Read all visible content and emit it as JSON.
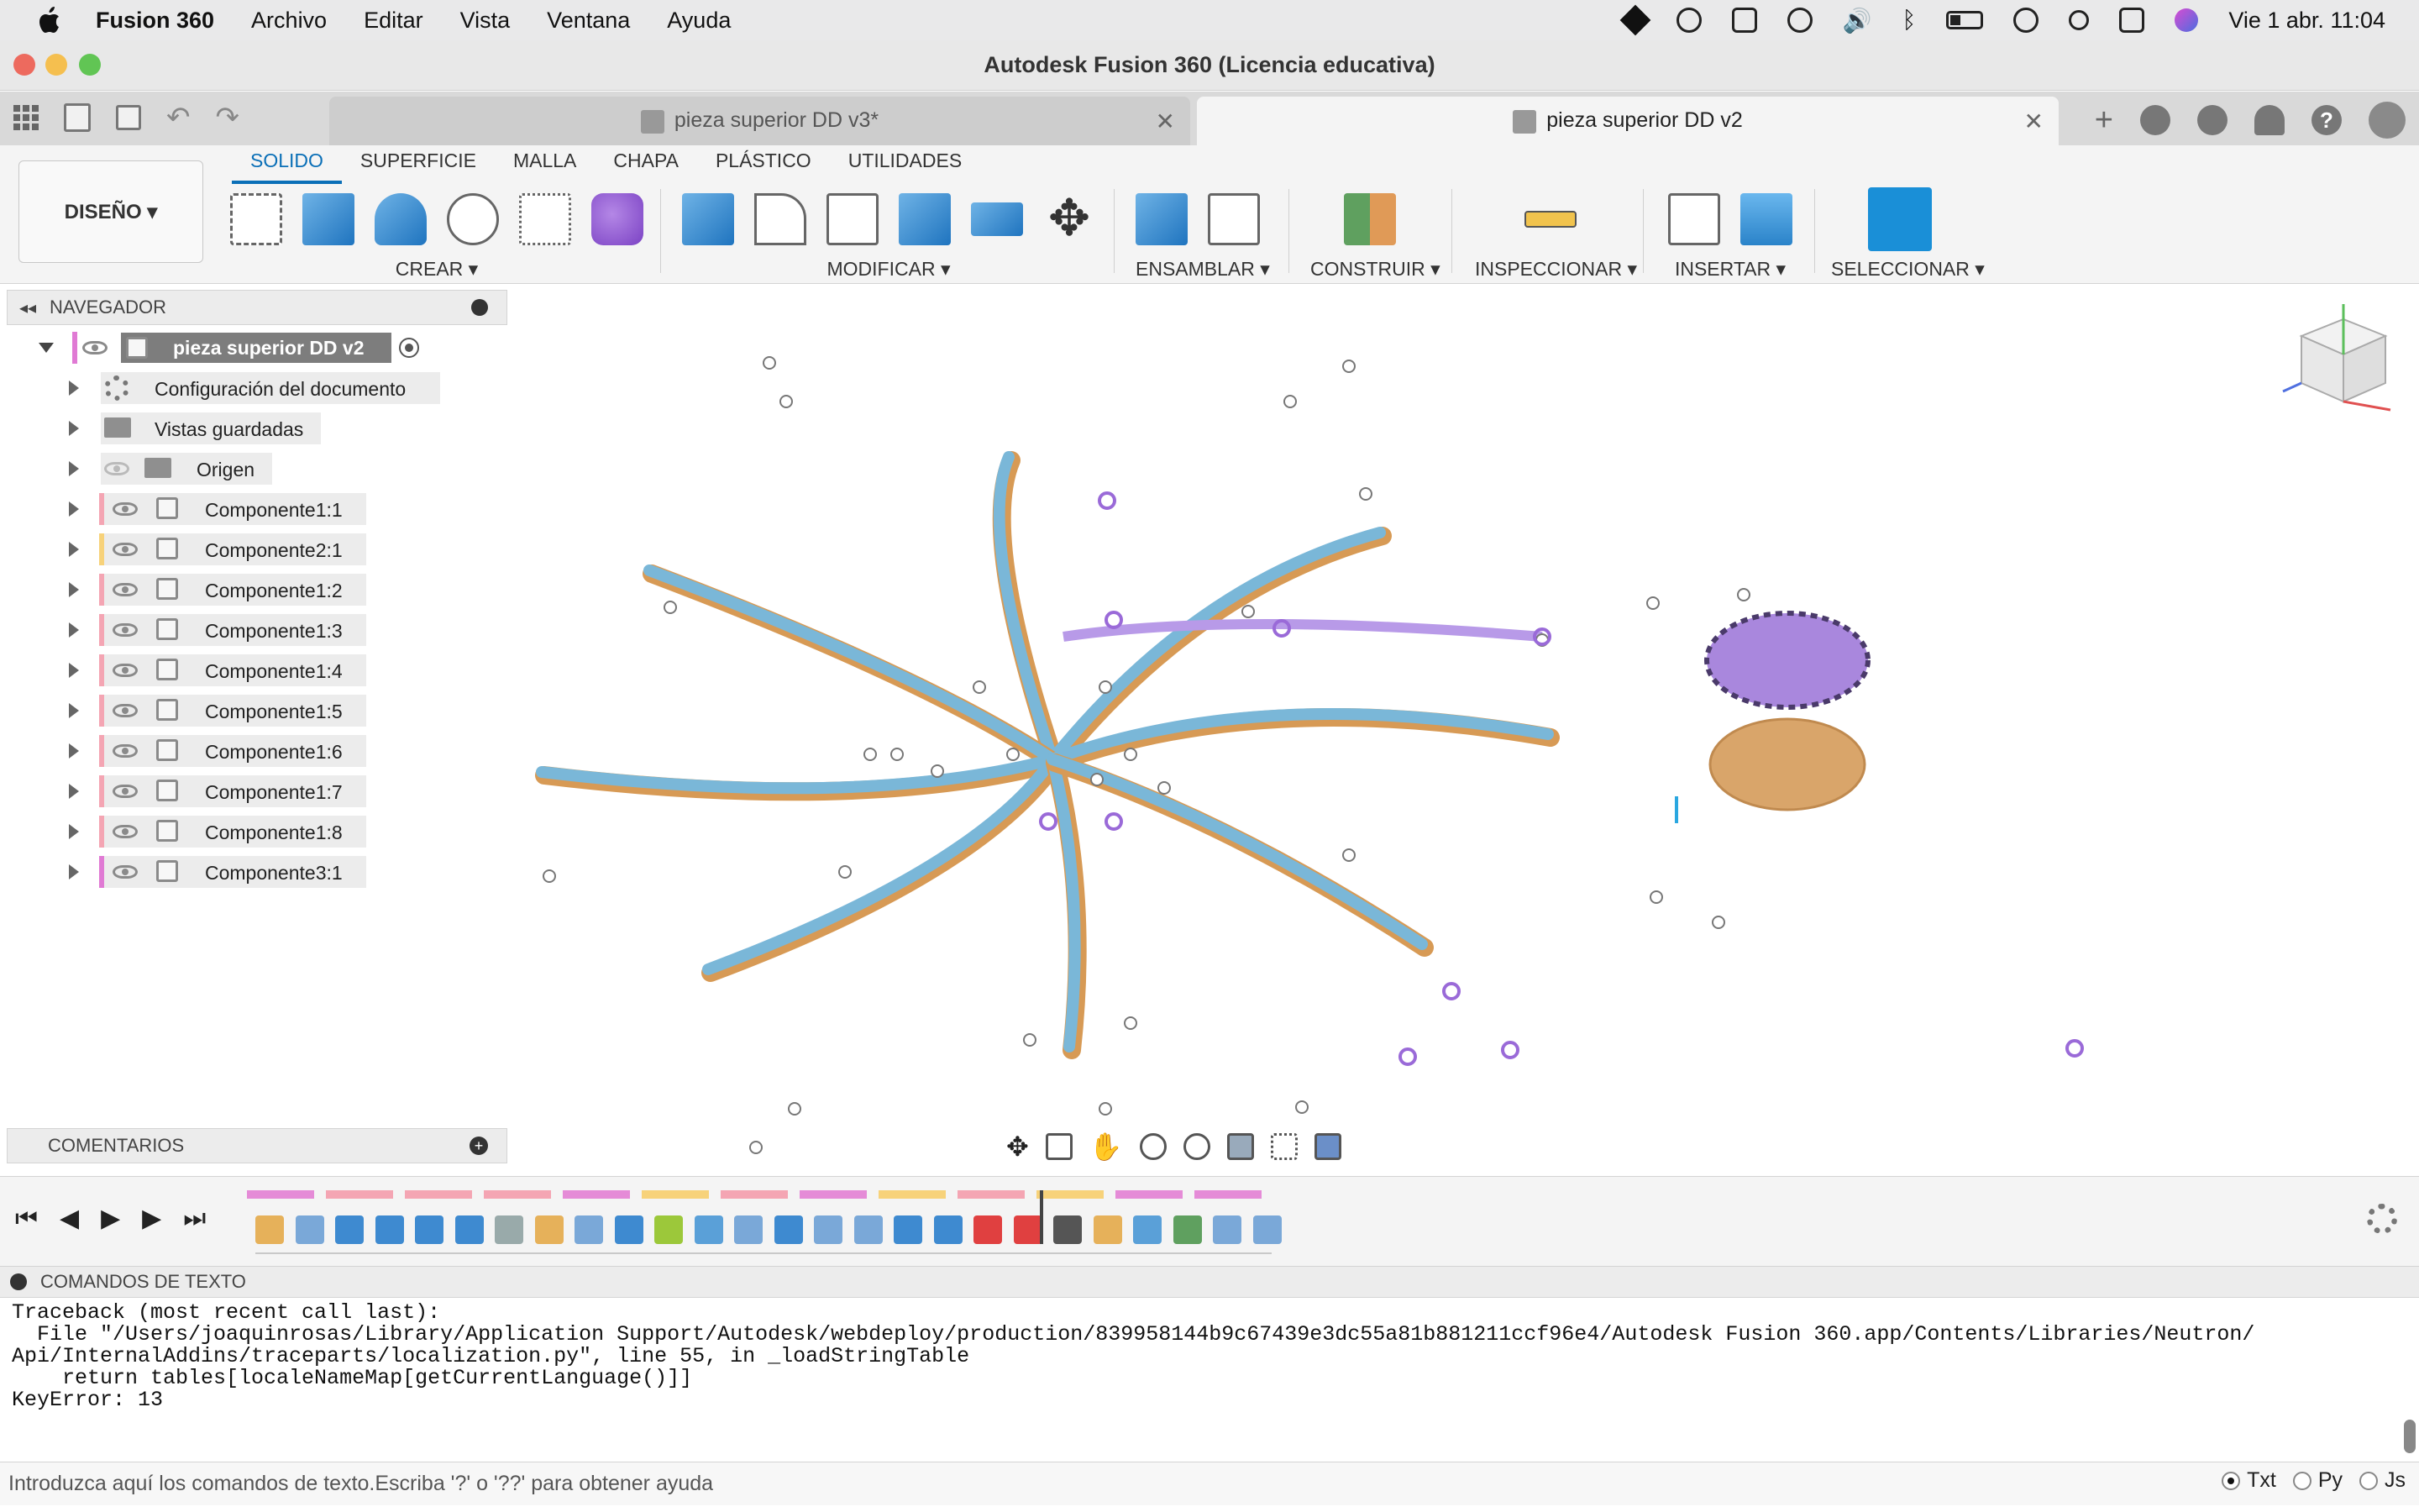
{
  "menubar": {
    "app_name": "Fusion 360",
    "items": [
      "Archivo",
      "Editar",
      "Vista",
      "Ventana",
      "Ayuda"
    ],
    "clock": "Vie 1 abr.  11:04"
  },
  "window": {
    "title": "Autodesk Fusion 360 (Licencia educativa)"
  },
  "tabs": [
    {
      "label": "pieza superior DD v3*",
      "active": false
    },
    {
      "label": "pieza superior DD v2",
      "active": true
    }
  ],
  "ribbon": {
    "workspace": "DISEÑO ▾",
    "tabs": [
      "SOLIDO",
      "SUPERFICIE",
      "MALLA",
      "CHAPA",
      "PLÁSTICO",
      "UTILIDADES"
    ],
    "groups": {
      "create": "CREAR ▾",
      "modify": "MODIFICAR ▾",
      "assemble": "ENSAMBLAR ▾",
      "construct": "CONSTRUIR ▾",
      "inspect": "INSPECCIONAR ▾",
      "insert": "INSERTAR ▾",
      "select": "SELECCIONAR ▾"
    }
  },
  "navigator": {
    "title": "NAVEGADOR",
    "root": "pieza superior DD v2",
    "items": [
      {
        "label": "Configuración del documento",
        "kind": "settings"
      },
      {
        "label": "Vistas guardadas",
        "kind": "folder"
      },
      {
        "label": "Origen",
        "kind": "origin"
      },
      {
        "label": "Componente1:1",
        "color": "#f4a5b3"
      },
      {
        "label": "Componente2:1",
        "color": "#f7d27a"
      },
      {
        "label": "Componente1:2",
        "color": "#f4a5b3"
      },
      {
        "label": "Componente1:3",
        "color": "#f4a5b3"
      },
      {
        "label": "Componente1:4",
        "color": "#f4a5b3"
      },
      {
        "label": "Componente1:5",
        "color": "#f4a5b3"
      },
      {
        "label": "Componente1:6",
        "color": "#f4a5b3"
      },
      {
        "label": "Componente1:7",
        "color": "#f4a5b3"
      },
      {
        "label": "Componente1:8",
        "color": "#f4a5b3"
      },
      {
        "label": "Componente3:1",
        "color": "#e07ad4"
      }
    ]
  },
  "comments": {
    "title": "COMENTARIOS"
  },
  "text_commands": {
    "title": "COMANDOS DE TEXTO",
    "output": "Traceback (most recent call last):\n  File \"/Users/joaquinrosas/Library/Application Support/Autodesk/webdeploy/production/839958144b9c67439e3dc55a81b881211ccf96e4/Autodesk Fusion 360.app/Contents/Libraries/Neutron/\nApi/InternalAddins/traceparts/localization.py\", line 55, in _loadStringTable\n    return tables[localeNameMap[getCurrentLanguage()]]\nKeyError: 13",
    "placeholder": "Introduzca aquí los comandos de texto.Escriba '?' o '??' para obtener ayuda",
    "modes": [
      "Txt",
      "Py",
      "Js"
    ],
    "selected_mode": "Txt"
  },
  "colors": {
    "accent": "#0a6fb7",
    "arm_blue": "#7ab7d8",
    "arm_orange": "#d79a55",
    "sketch_purple": "#9a6ad8"
  }
}
